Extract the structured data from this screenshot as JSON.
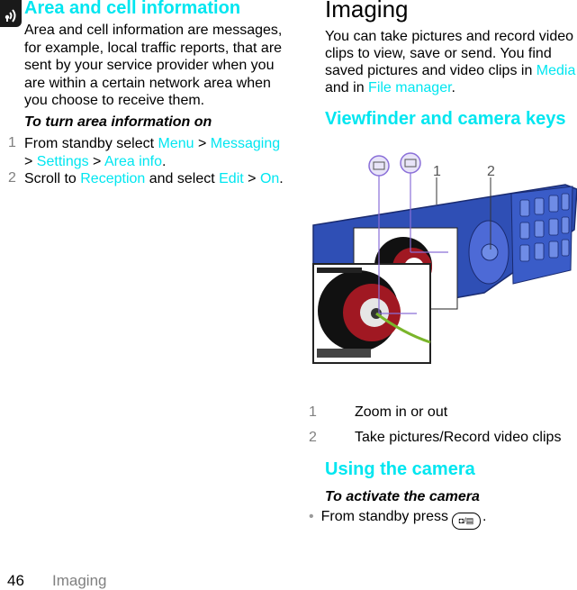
{
  "left_column": {
    "icon": "network-service-icon",
    "heading": "Area and cell information",
    "paragraph": "Area and cell information are messages, for example, local traffic reports, that are sent by your service provider when you are within a certain network area when you choose to receive them.",
    "procedure_title": "To turn area information on",
    "steps": [
      {
        "number": "1",
        "parts": [
          {
            "text": "From standby select ",
            "link": false
          },
          {
            "text": "Menu",
            "link": true
          },
          {
            "text": " > ",
            "link": false
          },
          {
            "text": "Messaging",
            "link": true
          },
          {
            "text": " > ",
            "link": false
          },
          {
            "text": "Settings",
            "link": true
          },
          {
            "text": " > ",
            "link": false
          },
          {
            "text": "Area info",
            "link": true
          },
          {
            "text": ".",
            "link": false
          }
        ]
      },
      {
        "number": "2",
        "parts": [
          {
            "text": "Scroll to ",
            "link": false
          },
          {
            "text": "Reception",
            "link": true
          },
          {
            "text": " and select ",
            "link": false
          },
          {
            "text": "Edit",
            "link": true
          },
          {
            "text": " > ",
            "link": false
          },
          {
            "text": "On",
            "link": true
          },
          {
            "text": ".",
            "link": false
          }
        ]
      }
    ]
  },
  "right_column": {
    "heading": "Imaging",
    "intro": {
      "text1": "You can take pictures and record video clips to view, save or send. You find saved pictures and video clips in ",
      "link1": "Media",
      "text2": " and in ",
      "link2": "File manager",
      "text3": "."
    },
    "subheading": "Viewfinder and camera keys",
    "figure": {
      "callouts": [
        "1",
        "2"
      ],
      "mode_icons": [
        "camera-mode-icon",
        "video-mode-icon"
      ]
    },
    "legend": [
      {
        "number": "1",
        "text": "Zoom in or out"
      },
      {
        "number": "2",
        "text": "Take pictures/Record video clips"
      }
    ],
    "section2_heading": "Using the camera",
    "procedure_title": "To activate the camera",
    "bullet": {
      "text": "From standby press",
      "key_icon": "camera-key-icon",
      "key_label": "◘/▤",
      "end": "."
    }
  },
  "footer": {
    "page_number": "46",
    "section": "Imaging"
  },
  "colors": {
    "link": "#00e6f0",
    "step_number": "#808080",
    "phone_body": "#2f4fb5"
  }
}
